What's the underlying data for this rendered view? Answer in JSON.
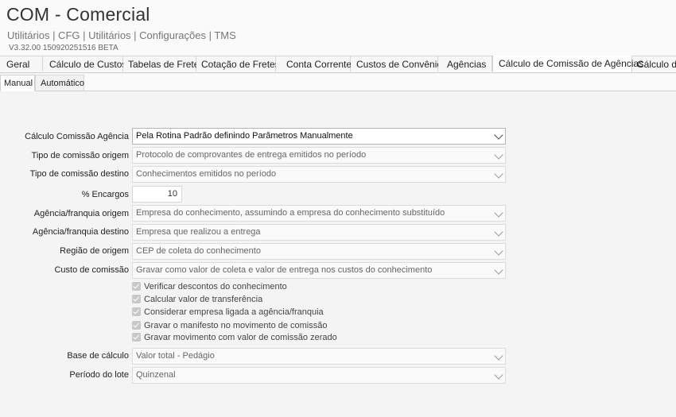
{
  "header": {
    "title": "COM - Comercial",
    "breadcrumb": "Utilitários | CFG | Utilitários | Configurações | TMS",
    "version": "V3.32.00 150920251516 BETA"
  },
  "tabs": [
    {
      "label": "Geral",
      "active": false
    },
    {
      "label": "Cálculo de Custos",
      "active": false
    },
    {
      "label": "Tabelas de Frete",
      "active": false
    },
    {
      "label": "Cotação de Fretes",
      "active": false
    },
    {
      "label": "Conta Corrente",
      "active": false
    },
    {
      "label": "Custos de Convênio",
      "active": false
    },
    {
      "label": "Agências",
      "active": false
    },
    {
      "label": "Cálculo de Comissão de Agências",
      "active": true
    },
    {
      "label": "Cálculo de",
      "active": false
    }
  ],
  "subtabs": [
    {
      "label": "Manual",
      "active": true
    },
    {
      "label": "Automático",
      "active": false
    }
  ],
  "form": {
    "calculo_comissao": {
      "label": "Cálculo Comissão Agência",
      "value": "Pela Rotina Padrão definindo Parâmetros Manualmente"
    },
    "tipo_origem": {
      "label": "Tipo de comissão origem",
      "value": "Protocolo de comprovantes de entrega emitidos no período"
    },
    "tipo_destino": {
      "label": "Tipo de comissão destino",
      "value": "Conhecimentos emitidos no período"
    },
    "encargos": {
      "label": "% Encargos",
      "value": "10"
    },
    "agencia_origem": {
      "label": "Agência/franquia origem",
      "value": "Empresa do conhecimento, assumindo a empresa do conhecimento substituído"
    },
    "agencia_destino": {
      "label": "Agência/franquia destino",
      "value": "Empresa que realizou a entrega"
    },
    "regiao_origem": {
      "label": "Região de origem",
      "value": "CEP de coleta do conhecimento"
    },
    "custo_comissao": {
      "label": "Custo de comissão",
      "value": "Gravar como valor de coleta e valor de entrega nos custos do conhecimento"
    },
    "checks": [
      {
        "label": "Verificar descontos do conhecimento",
        "checked": true
      },
      {
        "label": "Calcular valor de transferência",
        "checked": true
      },
      {
        "label": "Considerar empresa ligada a agência/franquia",
        "checked": true
      },
      {
        "label": "Gravar o manifesto no movimento de comissão",
        "checked": true
      },
      {
        "label": "Gravar movimento com valor de comissão zerado",
        "checked": true
      }
    ],
    "base_calculo": {
      "label": "Base de cálculo",
      "value": "Valor total - Pedágio"
    },
    "periodo_lote": {
      "label": "Período do lote",
      "value": "Quinzenal"
    }
  }
}
